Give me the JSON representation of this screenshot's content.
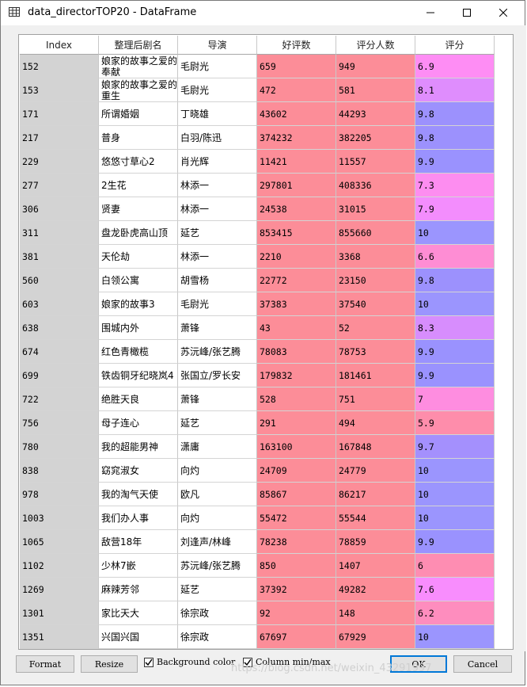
{
  "window": {
    "title": "data_directorTOP20 - DataFrame"
  },
  "table": {
    "columns": [
      "Index",
      "整理后剧名",
      "导演",
      "好评数",
      "评分人数",
      "评分"
    ],
    "rows": [
      {
        "index": "152",
        "name": "娘家的故事之爱的奉献",
        "director": "毛尉光",
        "good": "659",
        "raters": "949",
        "score": "6.9",
        "bg_good": "#fc8d98",
        "bg_raters": "#fc8d98",
        "bg_score": "#fe8df4"
      },
      {
        "index": "153",
        "name": "娘家的故事之爱的重生",
        "director": "毛尉光",
        "good": "472",
        "raters": "581",
        "score": "8.1",
        "bg_good": "#fc8d98",
        "bg_raters": "#fc8d98",
        "bg_score": "#df8dfd"
      },
      {
        "index": "171",
        "name": "所谓婚姻",
        "director": "丁晓雄",
        "good": "43602",
        "raters": "44293",
        "score": "9.8",
        "bg_good": "#fc8d98",
        "bg_raters": "#fc8d98",
        "bg_score": "#9c91fd"
      },
      {
        "index": "217",
        "name": "普身",
        "director": "白羽/陈迅",
        "good": "374232",
        "raters": "382205",
        "score": "9.8",
        "bg_good": "#fc8d98",
        "bg_raters": "#fc8d98",
        "bg_score": "#9c91fd"
      },
      {
        "index": "229",
        "name": "悠悠寸草心2",
        "director": "肖光辉",
        "good": "11421",
        "raters": "11557",
        "score": "9.9",
        "bg_good": "#fc8d98",
        "bg_raters": "#fc8d98",
        "bg_score": "#9a92fe"
      },
      {
        "index": "277",
        "name": "2生花",
        "director": "林添一",
        "good": "297801",
        "raters": "408336",
        "score": "7.3",
        "bg_good": "#fc8d98",
        "bg_raters": "#fc8d98",
        "bg_score": "#fd8df0"
      },
      {
        "index": "306",
        "name": "贤妻",
        "director": "林添一",
        "good": "24538",
        "raters": "31015",
        "score": "7.9",
        "bg_good": "#fc8d98",
        "bg_raters": "#fc8d98",
        "bg_score": "#f38dfd"
      },
      {
        "index": "311",
        "name": "盘龙卧虎高山顶",
        "director": "延艺",
        "good": "853415",
        "raters": "855660",
        "score": "10",
        "bg_good": "#fc8d98",
        "bg_raters": "#fc8d98",
        "bg_score": "#9b95fe"
      },
      {
        "index": "381",
        "name": "天伦劫",
        "director": "林添一",
        "good": "2210",
        "raters": "3368",
        "score": "6.6",
        "bg_good": "#fc8d98",
        "bg_raters": "#fc8d98",
        "bg_score": "#fe8dd4"
      },
      {
        "index": "560",
        "name": "白领公寓",
        "director": "胡雪杨",
        "good": "22772",
        "raters": "23150",
        "score": "9.8",
        "bg_good": "#fc8d98",
        "bg_raters": "#fc8d98",
        "bg_score": "#9c91fd"
      },
      {
        "index": "603",
        "name": "娘家的故事3",
        "director": "毛尉光",
        "good": "37383",
        "raters": "37540",
        "score": "10",
        "bg_good": "#fc8d98",
        "bg_raters": "#fc8d98",
        "bg_score": "#9b95fe"
      },
      {
        "index": "638",
        "name": "围城内外",
        "director": "萧锋",
        "good": "43",
        "raters": "52",
        "score": "8.3",
        "bg_good": "#fc8d98",
        "bg_raters": "#fc8d98",
        "bg_score": "#d78dfd"
      },
      {
        "index": "674",
        "name": "红色青橄榄",
        "director": "苏沅峰/张艺腾",
        "good": "78083",
        "raters": "78753",
        "score": "9.9",
        "bg_good": "#fc8d98",
        "bg_raters": "#fc8d98",
        "bg_score": "#9a92fe"
      },
      {
        "index": "699",
        "name": "铁齿铜牙纪晓岚4",
        "director": "张国立/罗长安",
        "good": "179832",
        "raters": "181461",
        "score": "9.9",
        "bg_good": "#fc8d98",
        "bg_raters": "#fc8d98",
        "bg_score": "#9a92fe"
      },
      {
        "index": "722",
        "name": "绝胜天良",
        "director": "萧锋",
        "good": "528",
        "raters": "751",
        "score": "7",
        "bg_good": "#fc8d98",
        "bg_raters": "#fc8d98",
        "bg_score": "#fe8de0"
      },
      {
        "index": "756",
        "name": "母子连心",
        "director": "延艺",
        "good": "291",
        "raters": "494",
        "score": "5.9",
        "bg_good": "#fc8d98",
        "bg_raters": "#fc8d98",
        "bg_score": "#fe8dab"
      },
      {
        "index": "780",
        "name": "我的超能男神",
        "director": "潇庸",
        "good": "163100",
        "raters": "167848",
        "score": "9.7",
        "bg_good": "#fc8d98",
        "bg_raters": "#fc8d98",
        "bg_score": "#a490fd"
      },
      {
        "index": "838",
        "name": "窈窕淑女",
        "director": "向灼",
        "good": "24709",
        "raters": "24779",
        "score": "10",
        "bg_good": "#fc8d98",
        "bg_raters": "#fc8d98",
        "bg_score": "#9b95fe"
      },
      {
        "index": "978",
        "name": "我的淘气天使",
        "director": "欧凡",
        "good": "85867",
        "raters": "86217",
        "score": "10",
        "bg_good": "#fc8d98",
        "bg_raters": "#fc8d98",
        "bg_score": "#9b95fe"
      },
      {
        "index": "1003",
        "name": "我们办人事",
        "director": "向灼",
        "good": "55472",
        "raters": "55544",
        "score": "10",
        "bg_good": "#fc8d98",
        "bg_raters": "#fc8d98",
        "bg_score": "#9b95fe"
      },
      {
        "index": "1065",
        "name": "敌营18年",
        "director": "刘逢声/林峰",
        "good": "78238",
        "raters": "78859",
        "score": "9.9",
        "bg_good": "#fc8d98",
        "bg_raters": "#fc8d98",
        "bg_score": "#9a92fe"
      },
      {
        "index": "1102",
        "name": "少林7嵌",
        "director": "苏沅峰/张艺腾",
        "good": "850",
        "raters": "1407",
        "score": "6",
        "bg_good": "#fc8d98",
        "bg_raters": "#fc8d98",
        "bg_score": "#fe8db2"
      },
      {
        "index": "1269",
        "name": "麻辣芳邻",
        "director": "延艺",
        "good": "37392",
        "raters": "49282",
        "score": "7.6",
        "bg_good": "#fc8d98",
        "bg_raters": "#fc8d98",
        "bg_score": "#f88dfd"
      },
      {
        "index": "1301",
        "name": "家比天大",
        "director": "徐宗政",
        "good": "92",
        "raters": "148",
        "score": "6.2",
        "bg_good": "#fc8d98",
        "bg_raters": "#fc8d98",
        "bg_score": "#fe8dbe"
      },
      {
        "index": "1351",
        "name": "兴国兴国",
        "director": "徐宗政",
        "good": "67697",
        "raters": "67929",
        "score": "10",
        "bg_good": "#fc8d98",
        "bg_raters": "#fc8d98",
        "bg_score": "#9b95fe"
      }
    ]
  },
  "buttons": {
    "format": "Format",
    "resize": "Resize",
    "ok": "OK",
    "cancel": "Cancel"
  },
  "checkboxes": {
    "background_color": {
      "label": "Background color",
      "checked": true
    },
    "column_minmax": {
      "label": "Column min/max",
      "checked": true
    }
  },
  "watermark": "https://blog.csdn.net/weixin_43291997"
}
